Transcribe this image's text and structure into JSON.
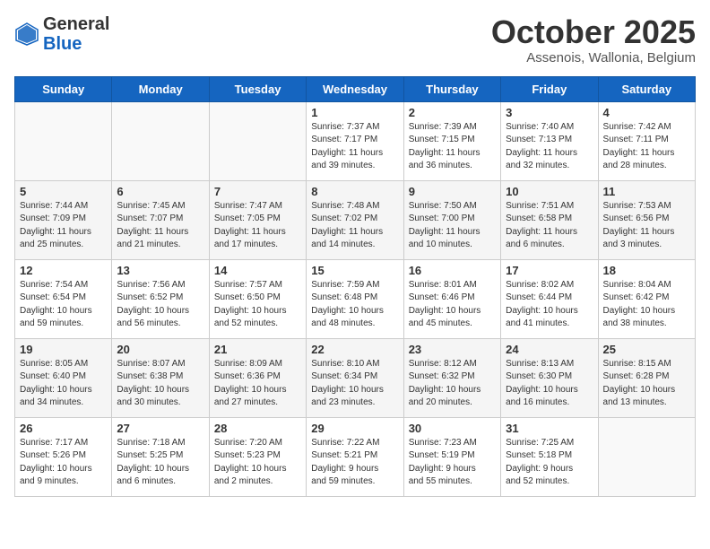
{
  "header": {
    "logo_general": "General",
    "logo_blue": "Blue",
    "month": "October 2025",
    "location": "Assenois, Wallonia, Belgium"
  },
  "days_of_week": [
    "Sunday",
    "Monday",
    "Tuesday",
    "Wednesday",
    "Thursday",
    "Friday",
    "Saturday"
  ],
  "weeks": [
    [
      {
        "day": "",
        "info": ""
      },
      {
        "day": "",
        "info": ""
      },
      {
        "day": "",
        "info": ""
      },
      {
        "day": "1",
        "info": "Sunrise: 7:37 AM\nSunset: 7:17 PM\nDaylight: 11 hours\nand 39 minutes."
      },
      {
        "day": "2",
        "info": "Sunrise: 7:39 AM\nSunset: 7:15 PM\nDaylight: 11 hours\nand 36 minutes."
      },
      {
        "day": "3",
        "info": "Sunrise: 7:40 AM\nSunset: 7:13 PM\nDaylight: 11 hours\nand 32 minutes."
      },
      {
        "day": "4",
        "info": "Sunrise: 7:42 AM\nSunset: 7:11 PM\nDaylight: 11 hours\nand 28 minutes."
      }
    ],
    [
      {
        "day": "5",
        "info": "Sunrise: 7:44 AM\nSunset: 7:09 PM\nDaylight: 11 hours\nand 25 minutes."
      },
      {
        "day": "6",
        "info": "Sunrise: 7:45 AM\nSunset: 7:07 PM\nDaylight: 11 hours\nand 21 minutes."
      },
      {
        "day": "7",
        "info": "Sunrise: 7:47 AM\nSunset: 7:05 PM\nDaylight: 11 hours\nand 17 minutes."
      },
      {
        "day": "8",
        "info": "Sunrise: 7:48 AM\nSunset: 7:02 PM\nDaylight: 11 hours\nand 14 minutes."
      },
      {
        "day": "9",
        "info": "Sunrise: 7:50 AM\nSunset: 7:00 PM\nDaylight: 11 hours\nand 10 minutes."
      },
      {
        "day": "10",
        "info": "Sunrise: 7:51 AM\nSunset: 6:58 PM\nDaylight: 11 hours\nand 6 minutes."
      },
      {
        "day": "11",
        "info": "Sunrise: 7:53 AM\nSunset: 6:56 PM\nDaylight: 11 hours\nand 3 minutes."
      }
    ],
    [
      {
        "day": "12",
        "info": "Sunrise: 7:54 AM\nSunset: 6:54 PM\nDaylight: 10 hours\nand 59 minutes."
      },
      {
        "day": "13",
        "info": "Sunrise: 7:56 AM\nSunset: 6:52 PM\nDaylight: 10 hours\nand 56 minutes."
      },
      {
        "day": "14",
        "info": "Sunrise: 7:57 AM\nSunset: 6:50 PM\nDaylight: 10 hours\nand 52 minutes."
      },
      {
        "day": "15",
        "info": "Sunrise: 7:59 AM\nSunset: 6:48 PM\nDaylight: 10 hours\nand 48 minutes."
      },
      {
        "day": "16",
        "info": "Sunrise: 8:01 AM\nSunset: 6:46 PM\nDaylight: 10 hours\nand 45 minutes."
      },
      {
        "day": "17",
        "info": "Sunrise: 8:02 AM\nSunset: 6:44 PM\nDaylight: 10 hours\nand 41 minutes."
      },
      {
        "day": "18",
        "info": "Sunrise: 8:04 AM\nSunset: 6:42 PM\nDaylight: 10 hours\nand 38 minutes."
      }
    ],
    [
      {
        "day": "19",
        "info": "Sunrise: 8:05 AM\nSunset: 6:40 PM\nDaylight: 10 hours\nand 34 minutes."
      },
      {
        "day": "20",
        "info": "Sunrise: 8:07 AM\nSunset: 6:38 PM\nDaylight: 10 hours\nand 30 minutes."
      },
      {
        "day": "21",
        "info": "Sunrise: 8:09 AM\nSunset: 6:36 PM\nDaylight: 10 hours\nand 27 minutes."
      },
      {
        "day": "22",
        "info": "Sunrise: 8:10 AM\nSunset: 6:34 PM\nDaylight: 10 hours\nand 23 minutes."
      },
      {
        "day": "23",
        "info": "Sunrise: 8:12 AM\nSunset: 6:32 PM\nDaylight: 10 hours\nand 20 minutes."
      },
      {
        "day": "24",
        "info": "Sunrise: 8:13 AM\nSunset: 6:30 PM\nDaylight: 10 hours\nand 16 minutes."
      },
      {
        "day": "25",
        "info": "Sunrise: 8:15 AM\nSunset: 6:28 PM\nDaylight: 10 hours\nand 13 minutes."
      }
    ],
    [
      {
        "day": "26",
        "info": "Sunrise: 7:17 AM\nSunset: 5:26 PM\nDaylight: 10 hours\nand 9 minutes."
      },
      {
        "day": "27",
        "info": "Sunrise: 7:18 AM\nSunset: 5:25 PM\nDaylight: 10 hours\nand 6 minutes."
      },
      {
        "day": "28",
        "info": "Sunrise: 7:20 AM\nSunset: 5:23 PM\nDaylight: 10 hours\nand 2 minutes."
      },
      {
        "day": "29",
        "info": "Sunrise: 7:22 AM\nSunset: 5:21 PM\nDaylight: 9 hours\nand 59 minutes."
      },
      {
        "day": "30",
        "info": "Sunrise: 7:23 AM\nSunset: 5:19 PM\nDaylight: 9 hours\nand 55 minutes."
      },
      {
        "day": "31",
        "info": "Sunrise: 7:25 AM\nSunset: 5:18 PM\nDaylight: 9 hours\nand 52 minutes."
      },
      {
        "day": "",
        "info": ""
      }
    ]
  ]
}
